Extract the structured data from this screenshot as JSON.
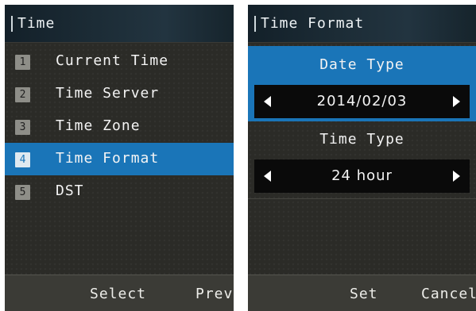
{
  "left_panel": {
    "title": "Time",
    "menu": [
      {
        "number": "1",
        "label": "Current Time",
        "selected": false
      },
      {
        "number": "2",
        "label": "Time Server",
        "selected": false
      },
      {
        "number": "3",
        "label": "Time Zone",
        "selected": false
      },
      {
        "number": "4",
        "label": "Time Format",
        "selected": true
      },
      {
        "number": "5",
        "label": "DST",
        "selected": false
      }
    ],
    "softkeys": {
      "left": "Select",
      "right": "Prev"
    }
  },
  "right_panel": {
    "title": "Time Format",
    "date_type": {
      "label": "Date Type",
      "value": "2014/02/03"
    },
    "time_type": {
      "label": "Time Type",
      "value": "24 hour"
    },
    "softkeys": {
      "left": "Set",
      "right": "Cancel"
    }
  },
  "colors": {
    "highlight": "#1a75b8",
    "background": "#2b2b27",
    "softkey_bar": "#3b3b36"
  }
}
